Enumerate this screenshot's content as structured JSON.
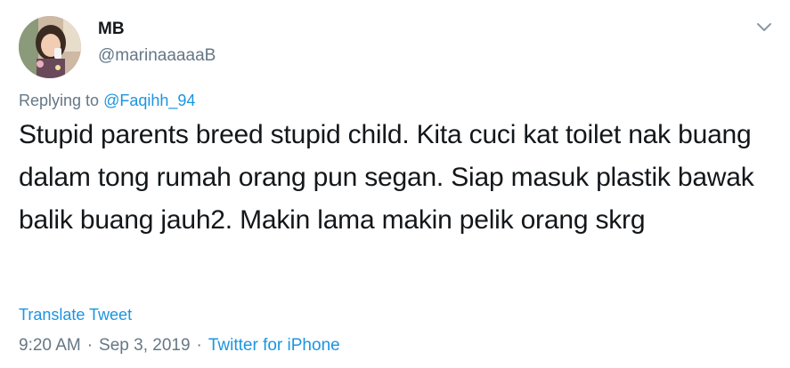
{
  "author": {
    "name": "MB",
    "handle": "@marinaaaaaB"
  },
  "reply": {
    "prefix": "Replying to",
    "to": "@Faqihh_94"
  },
  "tweet": {
    "text": "Stupid parents breed stupid child. Kita cuci kat toilet nak buang dalam tong rumah orang pun segan. Siap masuk plastik bawak balik buang jauh2. Makin lama makin pelik orang skrg"
  },
  "actions": {
    "translate": "Translate Tweet",
    "menu_icon": "chevron-down-icon"
  },
  "meta": {
    "time": "9:20 AM",
    "separator": "·",
    "date": "Sep 3, 2019",
    "source": "Twitter for iPhone"
  },
  "colors": {
    "link": "#1b95e0",
    "secondary": "#657786",
    "primary_text": "#14171a"
  }
}
